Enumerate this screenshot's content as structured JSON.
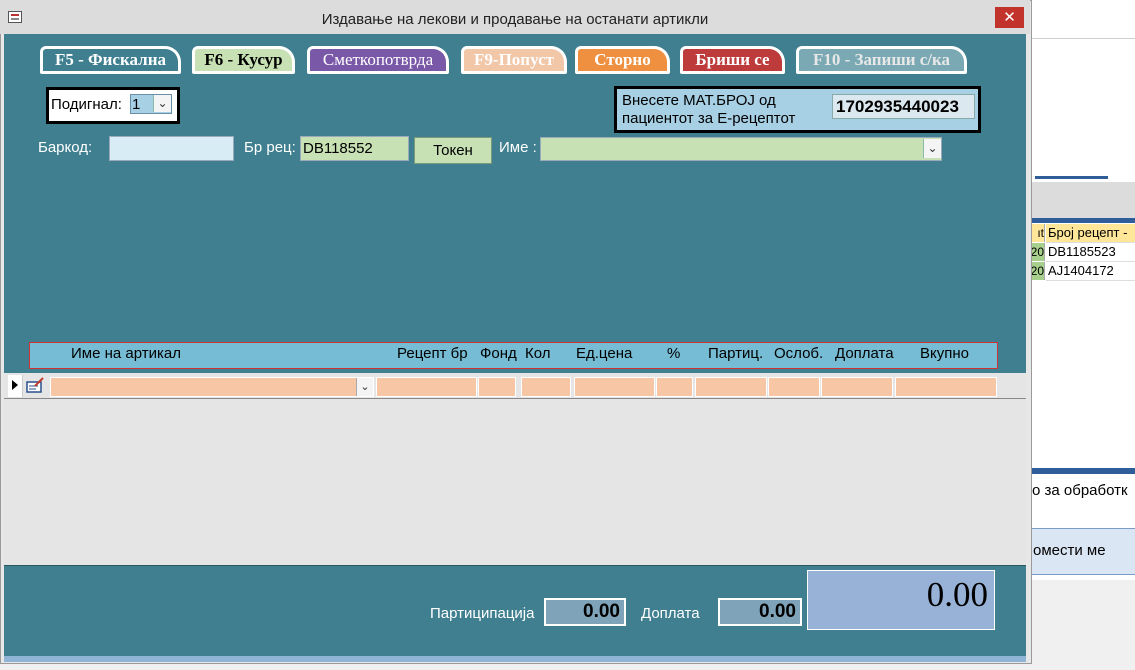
{
  "window": {
    "title": "Издавање на лекови и продавање на останати артикли",
    "close_glyph": "✕"
  },
  "toolbar": {
    "f5": "F5 - Фискална",
    "f6": "F6 - Кусур",
    "smetko": "Сметкопотврда",
    "f9": "F9-Попуст",
    "storno": "Сторно",
    "brisi": "Бриши се",
    "f10": "F10 - Запиши с/ка"
  },
  "podignal": {
    "label": "Подигнал:",
    "value": "1"
  },
  "mat_broj": {
    "label": "Внесете МАТ.БРОЈ од пациентот за Е-рецептот",
    "value": "1702935440023"
  },
  "form": {
    "barkod_label": "Баркод:",
    "barkod_value": "",
    "br_rec_label": "Бр рец:",
    "br_rec_value": "DB118552",
    "token_label": "Токен",
    "ime_label": "Име :",
    "ime_value": ""
  },
  "columns": [
    "Име на артикал",
    "Рецепт бр",
    "Фонд",
    "Кол",
    "Ед.цена",
    "%",
    "Партиц.",
    "Ослоб.",
    "Доплата",
    "Вкупно"
  ],
  "footer": {
    "participacija_label": "Партиципација",
    "participacija_value": "0.00",
    "doplata_label": "Доплата",
    "doplata_value": "0.00",
    "total": "0.00"
  },
  "background_app": {
    "table_header": {
      "c1": "ıt",
      "c2": "Број рецепт -"
    },
    "rows": [
      {
        "c1": "20",
        "c2": "DB1185523"
      },
      {
        "c1": "20",
        "c2": "AJ1404172"
      }
    ],
    "status_text": "о за обработк",
    "button_text": "омести ме"
  },
  "icons": {
    "dropdown": "chevron-down-icon",
    "record_selector": "triangle-right-icon",
    "edit": "edit-record-icon",
    "app": "form-icon"
  }
}
